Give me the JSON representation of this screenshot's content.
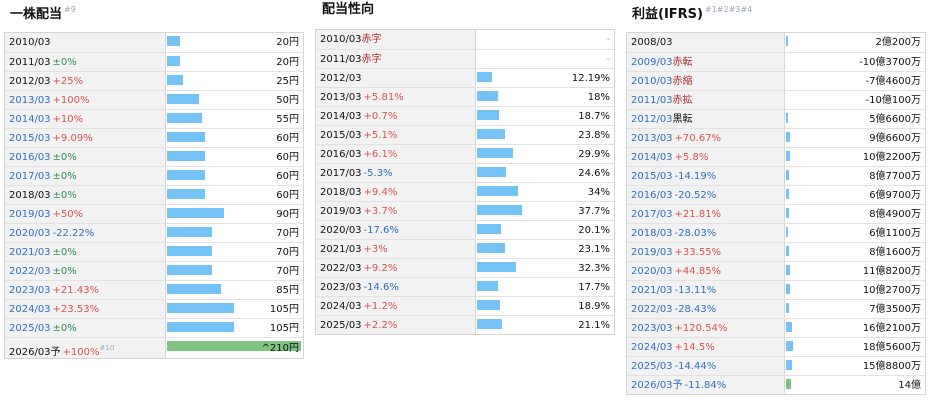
{
  "dividends": {
    "title": "一株配当",
    "footnote": "#9",
    "rows": [
      {
        "year": "2010/03",
        "year_style": "black",
        "change": "",
        "change_dir": "",
        "value": "20円",
        "bar": 20
      },
      {
        "year": "2011/03",
        "year_style": "black",
        "change": "±0%",
        "change_dir": "flat",
        "value": "20円",
        "bar": 20
      },
      {
        "year": "2012/03",
        "year_style": "black",
        "change": "+25%",
        "change_dir": "up",
        "value": "25円",
        "bar": 25
      },
      {
        "year": "2013/03",
        "year_style": "blue",
        "change": "+100%",
        "change_dir": "up",
        "value": "50円",
        "bar": 50
      },
      {
        "year": "2014/03",
        "year_style": "blue",
        "change": "+10%",
        "change_dir": "up",
        "value": "55円",
        "bar": 55
      },
      {
        "year": "2015/03",
        "year_style": "blue",
        "change": "+9.09%",
        "change_dir": "up",
        "value": "60円",
        "bar": 60
      },
      {
        "year": "2016/03",
        "year_style": "blue",
        "change": "±0%",
        "change_dir": "flat",
        "value": "60円",
        "bar": 60
      },
      {
        "year": "2017/03",
        "year_style": "blue",
        "change": "±0%",
        "change_dir": "flat",
        "value": "60円",
        "bar": 60
      },
      {
        "year": "2018/03",
        "year_style": "black",
        "change": "±0%",
        "change_dir": "flat",
        "value": "60円",
        "bar": 60
      },
      {
        "year": "2019/03",
        "year_style": "blue",
        "change": "+50%",
        "change_dir": "up",
        "value": "90円",
        "bar": 90
      },
      {
        "year": "2020/03",
        "year_style": "blue",
        "change": "-22.22%",
        "change_dir": "down",
        "value": "70円",
        "bar": 70
      },
      {
        "year": "2021/03",
        "year_style": "blue",
        "change": "±0%",
        "change_dir": "flat",
        "value": "70円",
        "bar": 70
      },
      {
        "year": "2022/03",
        "year_style": "blue",
        "change": "±0%",
        "change_dir": "flat",
        "value": "70円",
        "bar": 70
      },
      {
        "year": "2023/03",
        "year_style": "blue",
        "change": "+21.43%",
        "change_dir": "up",
        "value": "85円",
        "bar": 85
      },
      {
        "year": "2024/03",
        "year_style": "blue",
        "change": "+23.53%",
        "change_dir": "up",
        "value": "105円",
        "bar": 105
      },
      {
        "year": "2025/03",
        "year_style": "blue",
        "change": "±0%",
        "change_dir": "flat",
        "value": "105円",
        "bar": 105
      },
      {
        "year": "2026/03予",
        "year_style": "black",
        "change": "+100%",
        "change_dir": "up",
        "footnote": "#10",
        "value": "^210円",
        "bar": 210,
        "forecast": true
      }
    ],
    "bar_max": 210
  },
  "payout": {
    "title": "配当性向",
    "rows": [
      {
        "year": "2010/03",
        "note": "赤字",
        "value": "-",
        "bar": 0,
        "dash": true
      },
      {
        "year": "2011/03",
        "note": "赤字",
        "value": "-",
        "bar": 0,
        "dash": true
      },
      {
        "year": "2012/03",
        "change": "",
        "change_dir": "",
        "value": "12.19%",
        "bar": 12.19
      },
      {
        "year": "2013/03",
        "change": "+5.81%",
        "change_dir": "up",
        "value": "18%",
        "bar": 18
      },
      {
        "year": "2014/03",
        "change": "+0.7%",
        "change_dir": "up",
        "value": "18.7%",
        "bar": 18.7
      },
      {
        "year": "2015/03",
        "change": "+5.1%",
        "change_dir": "up",
        "value": "23.8%",
        "bar": 23.8
      },
      {
        "year": "2016/03",
        "change": "+6.1%",
        "change_dir": "up",
        "value": "29.9%",
        "bar": 29.9
      },
      {
        "year": "2017/03",
        "change": "-5.3%",
        "change_dir": "down",
        "value": "24.6%",
        "bar": 24.6
      },
      {
        "year": "2018/03",
        "change": "+9.4%",
        "change_dir": "up",
        "value": "34%",
        "bar": 34
      },
      {
        "year": "2019/03",
        "change": "+3.7%",
        "change_dir": "up",
        "value": "37.7%",
        "bar": 37.7
      },
      {
        "year": "2020/03",
        "change": "-17.6%",
        "change_dir": "down",
        "value": "20.1%",
        "bar": 20.1
      },
      {
        "year": "2021/03",
        "change": "+3%",
        "change_dir": "up",
        "value": "23.1%",
        "bar": 23.1
      },
      {
        "year": "2022/03",
        "change": "+9.2%",
        "change_dir": "up",
        "value": "32.3%",
        "bar": 32.3
      },
      {
        "year": "2023/03",
        "change": "-14.6%",
        "change_dir": "down",
        "value": "17.7%",
        "bar": 17.7
      },
      {
        "year": "2024/03",
        "change": "+1.2%",
        "change_dir": "up",
        "value": "18.9%",
        "bar": 18.9
      },
      {
        "year": "2025/03",
        "change": "+2.2%",
        "change_dir": "up",
        "value": "21.1%",
        "bar": 21.1
      }
    ],
    "bar_max": 37.7
  },
  "profit": {
    "title": "利益(IFRS)",
    "footnote": "#1#2#3#4",
    "rows": [
      {
        "year": "2008/03",
        "year_style": "black",
        "note": "",
        "change": "",
        "change_dir": "",
        "value": "2億200万",
        "bar": 2.02
      },
      {
        "year": "2009/03",
        "year_style": "blue",
        "note": "赤転",
        "change": "",
        "value": "-10億3700万",
        "bar": 0
      },
      {
        "year": "2010/03",
        "year_style": "blue",
        "note": "赤縮",
        "change": "",
        "value": "-7億4600万",
        "bar": 0
      },
      {
        "year": "2011/03",
        "year_style": "blue",
        "note": "赤拡",
        "change": "",
        "value": "-10億100万",
        "bar": 0
      },
      {
        "year": "2012/03",
        "year_style": "blue",
        "note": "黒転",
        "note_dark": true,
        "change": "",
        "value": "5億6600万",
        "bar": 5.66
      },
      {
        "year": "2013/03",
        "year_style": "blue",
        "change": "+70.67%",
        "change_dir": "up",
        "value": "9億6600万",
        "bar": 9.66
      },
      {
        "year": "2014/03",
        "year_style": "blue",
        "change": "+5.8%",
        "change_dir": "up",
        "value": "10億2200万",
        "bar": 10.22
      },
      {
        "year": "2015/03",
        "year_style": "blue",
        "change": "-14.19%",
        "change_dir": "down",
        "value": "8億7700万",
        "bar": 8.77
      },
      {
        "year": "2016/03",
        "year_style": "blue",
        "change": "-20.52%",
        "change_dir": "down",
        "value": "6億9700万",
        "bar": 6.97
      },
      {
        "year": "2017/03",
        "year_style": "blue",
        "change": "+21.81%",
        "change_dir": "up",
        "value": "8億4900万",
        "bar": 8.49
      },
      {
        "year": "2018/03",
        "year_style": "blue",
        "change": "-28.03%",
        "change_dir": "down",
        "value": "6億1100万",
        "bar": 6.11
      },
      {
        "year": "2019/03",
        "year_style": "blue",
        "change": "+33.55%",
        "change_dir": "up",
        "value": "8億1600万",
        "bar": 8.16
      },
      {
        "year": "2020/03",
        "year_style": "blue",
        "change": "+44.85%",
        "change_dir": "up",
        "value": "11億8200万",
        "bar": 11.82
      },
      {
        "year": "2021/03",
        "year_style": "blue",
        "change": "-13.11%",
        "change_dir": "down",
        "value": "10億2700万",
        "bar": 10.27
      },
      {
        "year": "2022/03",
        "year_style": "blue",
        "change": "-28.43%",
        "change_dir": "down",
        "value": "7億3500万",
        "bar": 7.35
      },
      {
        "year": "2023/03",
        "year_style": "blue",
        "change": "+120.54%",
        "change_dir": "up",
        "value": "16億2100万",
        "bar": 16.21
      },
      {
        "year": "2024/03",
        "year_style": "blue",
        "change": "+14.5%",
        "change_dir": "up",
        "value": "18億5600万",
        "bar": 18.56
      },
      {
        "year": "2025/03",
        "year_style": "blue",
        "change": "-14.44%",
        "change_dir": "down",
        "value": "15億8800万",
        "bar": 15.88
      },
      {
        "year": "2026/03予",
        "year_style": "blue",
        "change": "-11.84%",
        "change_dir": "down",
        "value": "14億",
        "bar": 14,
        "forecast": true
      }
    ],
    "bar_max": 400
  },
  "colors": {
    "bar": "#74c3f4",
    "forecast_bar": "#7cc47f",
    "up": "#d9534f",
    "down": "#2f6fc0",
    "flat": "#2e8b57"
  }
}
